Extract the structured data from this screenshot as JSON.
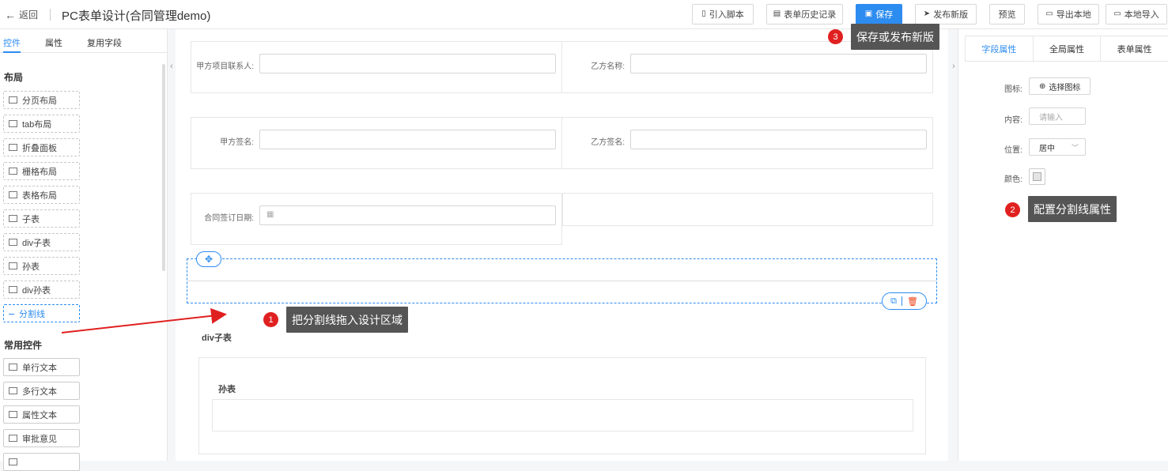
{
  "header": {
    "back_label": "返回",
    "title": "PC表单设计(合同管理demo)",
    "buttons": {
      "import_script": "引入脚本",
      "history": "表单历史记录",
      "save": "保存",
      "publish": "发布新版",
      "preview": "预览",
      "export_local": "导出本地",
      "import_local": "本地导入"
    }
  },
  "left_panel": {
    "tabs": [
      "控件",
      "属性",
      "复用字段"
    ],
    "layout_section": "布局",
    "layout_items": [
      "分页布局",
      "tab布局",
      "折叠面板",
      "栅格布局",
      "表格布局",
      "子表",
      "div子表",
      "孙表",
      "div孙表",
      "分割线"
    ],
    "common_section": "常用控件",
    "common_items": [
      "单行文本",
      "多行文本",
      "属性文本",
      "审批意见"
    ]
  },
  "canvas": {
    "fields": {
      "party_a_contact": "甲方项目联系人:",
      "party_b_name": "乙方名称:",
      "party_a_sign": "甲方签名:",
      "party_b_sign": "乙方签名:",
      "sign_date": "合同签订日期:"
    },
    "div_subtable_title": "div子表",
    "grandchild_title": "孙表"
  },
  "right_panel": {
    "tabs": [
      "字段属性",
      "全局属性",
      "表单属性"
    ],
    "icon_label": "图标:",
    "icon_button": "选择图标",
    "content_label": "内容:",
    "content_placeholder": "请输入",
    "position_label": "位置:",
    "position_value": "居中",
    "color_label": "颜色:"
  },
  "annotations": {
    "tip1": "把分割线拖入设计区域",
    "tip2": "配置分割线属性",
    "tip3": "保存或发布新版",
    "badge1": "1",
    "badge2": "2",
    "badge3": "3"
  },
  "colors": {
    "primary": "#2d8cf0",
    "badge": "#e02020",
    "tooltip": "#555555",
    "arrow": "#e02020"
  }
}
